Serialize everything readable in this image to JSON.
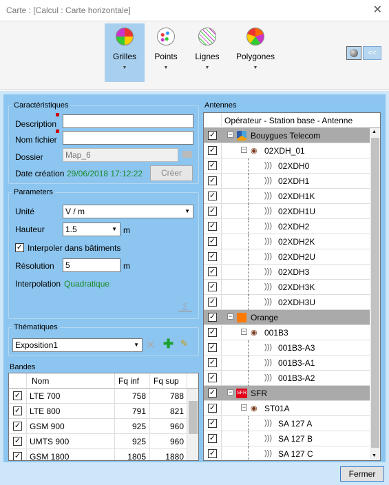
{
  "window": {
    "title": "Carte :  [Calcul : Carte horizontale]",
    "close": "✕"
  },
  "ribbon": {
    "items": [
      {
        "label": "Grilles",
        "active": true
      },
      {
        "label": "Points"
      },
      {
        "label": "Lignes"
      },
      {
        "label": "Polygones"
      }
    ],
    "collapse": "<<"
  },
  "caracteristiques": {
    "legend": "Caractéristiques",
    "description_label": "Description",
    "description_value": "",
    "nomfichier_label": "Nom fichier",
    "nomfichier_value": "",
    "dossier_label": "Dossier",
    "dossier_value": "Map_6",
    "date_label": "Date création",
    "date_value": "29/06/2018 17:12:22",
    "creer": "Créer"
  },
  "parameters": {
    "legend": "Parameters",
    "unite_label": "Unité",
    "unite_value": "V / m",
    "hauteur_label": "Hauteur",
    "hauteur_value": "1.5",
    "hauteur_unit": "m",
    "interpoler_label": "Interpoler dans bâtiments",
    "interpoler_checked": true,
    "resolution_label": "Résolution",
    "resolution_value": "5",
    "resolution_unit": "m",
    "interpolation_label": "Interpolation",
    "interpolation_value": "Quadratique"
  },
  "thematiques": {
    "legend": "Thématiques",
    "value": "Exposition1"
  },
  "bandes": {
    "legend": "Bandes",
    "columns": [
      "Nom",
      "Fq inf",
      "Fq sup"
    ],
    "rows": [
      {
        "nom": "LTE 700",
        "inf": "758",
        "sup": "788"
      },
      {
        "nom": "LTE 800",
        "inf": "791",
        "sup": "821"
      },
      {
        "nom": "GSM 900",
        "inf": "925",
        "sup": "960"
      },
      {
        "nom": "UMTS 900",
        "inf": "925",
        "sup": "960"
      },
      {
        "nom": "GSM 1800",
        "inf": "1805",
        "sup": "1880"
      }
    ]
  },
  "antennes": {
    "legend": "Antennes",
    "header": "Opérateur - Station base - Antenne",
    "rows": [
      {
        "label": "Bouygues Telecom",
        "level": 0,
        "type": "op"
      },
      {
        "label": "02XDH_01",
        "level": 1,
        "type": "station"
      },
      {
        "label": "02XDH0",
        "level": 2,
        "type": "antenna"
      },
      {
        "label": "02XDH1",
        "level": 2,
        "type": "antenna"
      },
      {
        "label": "02XDH1K",
        "level": 2,
        "type": "antenna"
      },
      {
        "label": "02XDH1U",
        "level": 2,
        "type": "antenna"
      },
      {
        "label": "02XDH2",
        "level": 2,
        "type": "antenna"
      },
      {
        "label": "02XDH2K",
        "level": 2,
        "type": "antenna"
      },
      {
        "label": "02XDH2U",
        "level": 2,
        "type": "antenna"
      },
      {
        "label": "02XDH3",
        "level": 2,
        "type": "antenna"
      },
      {
        "label": "02XDH3K",
        "level": 2,
        "type": "antenna"
      },
      {
        "label": "02XDH3U",
        "level": 2,
        "type": "antenna"
      },
      {
        "label": "Orange",
        "level": 0,
        "type": "op"
      },
      {
        "label": "001B3",
        "level": 1,
        "type": "station"
      },
      {
        "label": "001B3-A3",
        "level": 2,
        "type": "antenna"
      },
      {
        "label": "001B3-A1",
        "level": 2,
        "type": "antenna"
      },
      {
        "label": "001B3-A2",
        "level": 2,
        "type": "antenna"
      },
      {
        "label": "SFR",
        "level": 0,
        "type": "op"
      },
      {
        "label": "ST01A",
        "level": 1,
        "type": "station"
      },
      {
        "label": "SA 127 A",
        "level": 2,
        "type": "antenna"
      },
      {
        "label": "SA 127 B",
        "level": 2,
        "type": "antenna"
      },
      {
        "label": "SA 127 C",
        "level": 2,
        "type": "antenna"
      }
    ],
    "sfr_badge": "SFR"
  },
  "footer": {
    "fermer": "Fermer"
  }
}
